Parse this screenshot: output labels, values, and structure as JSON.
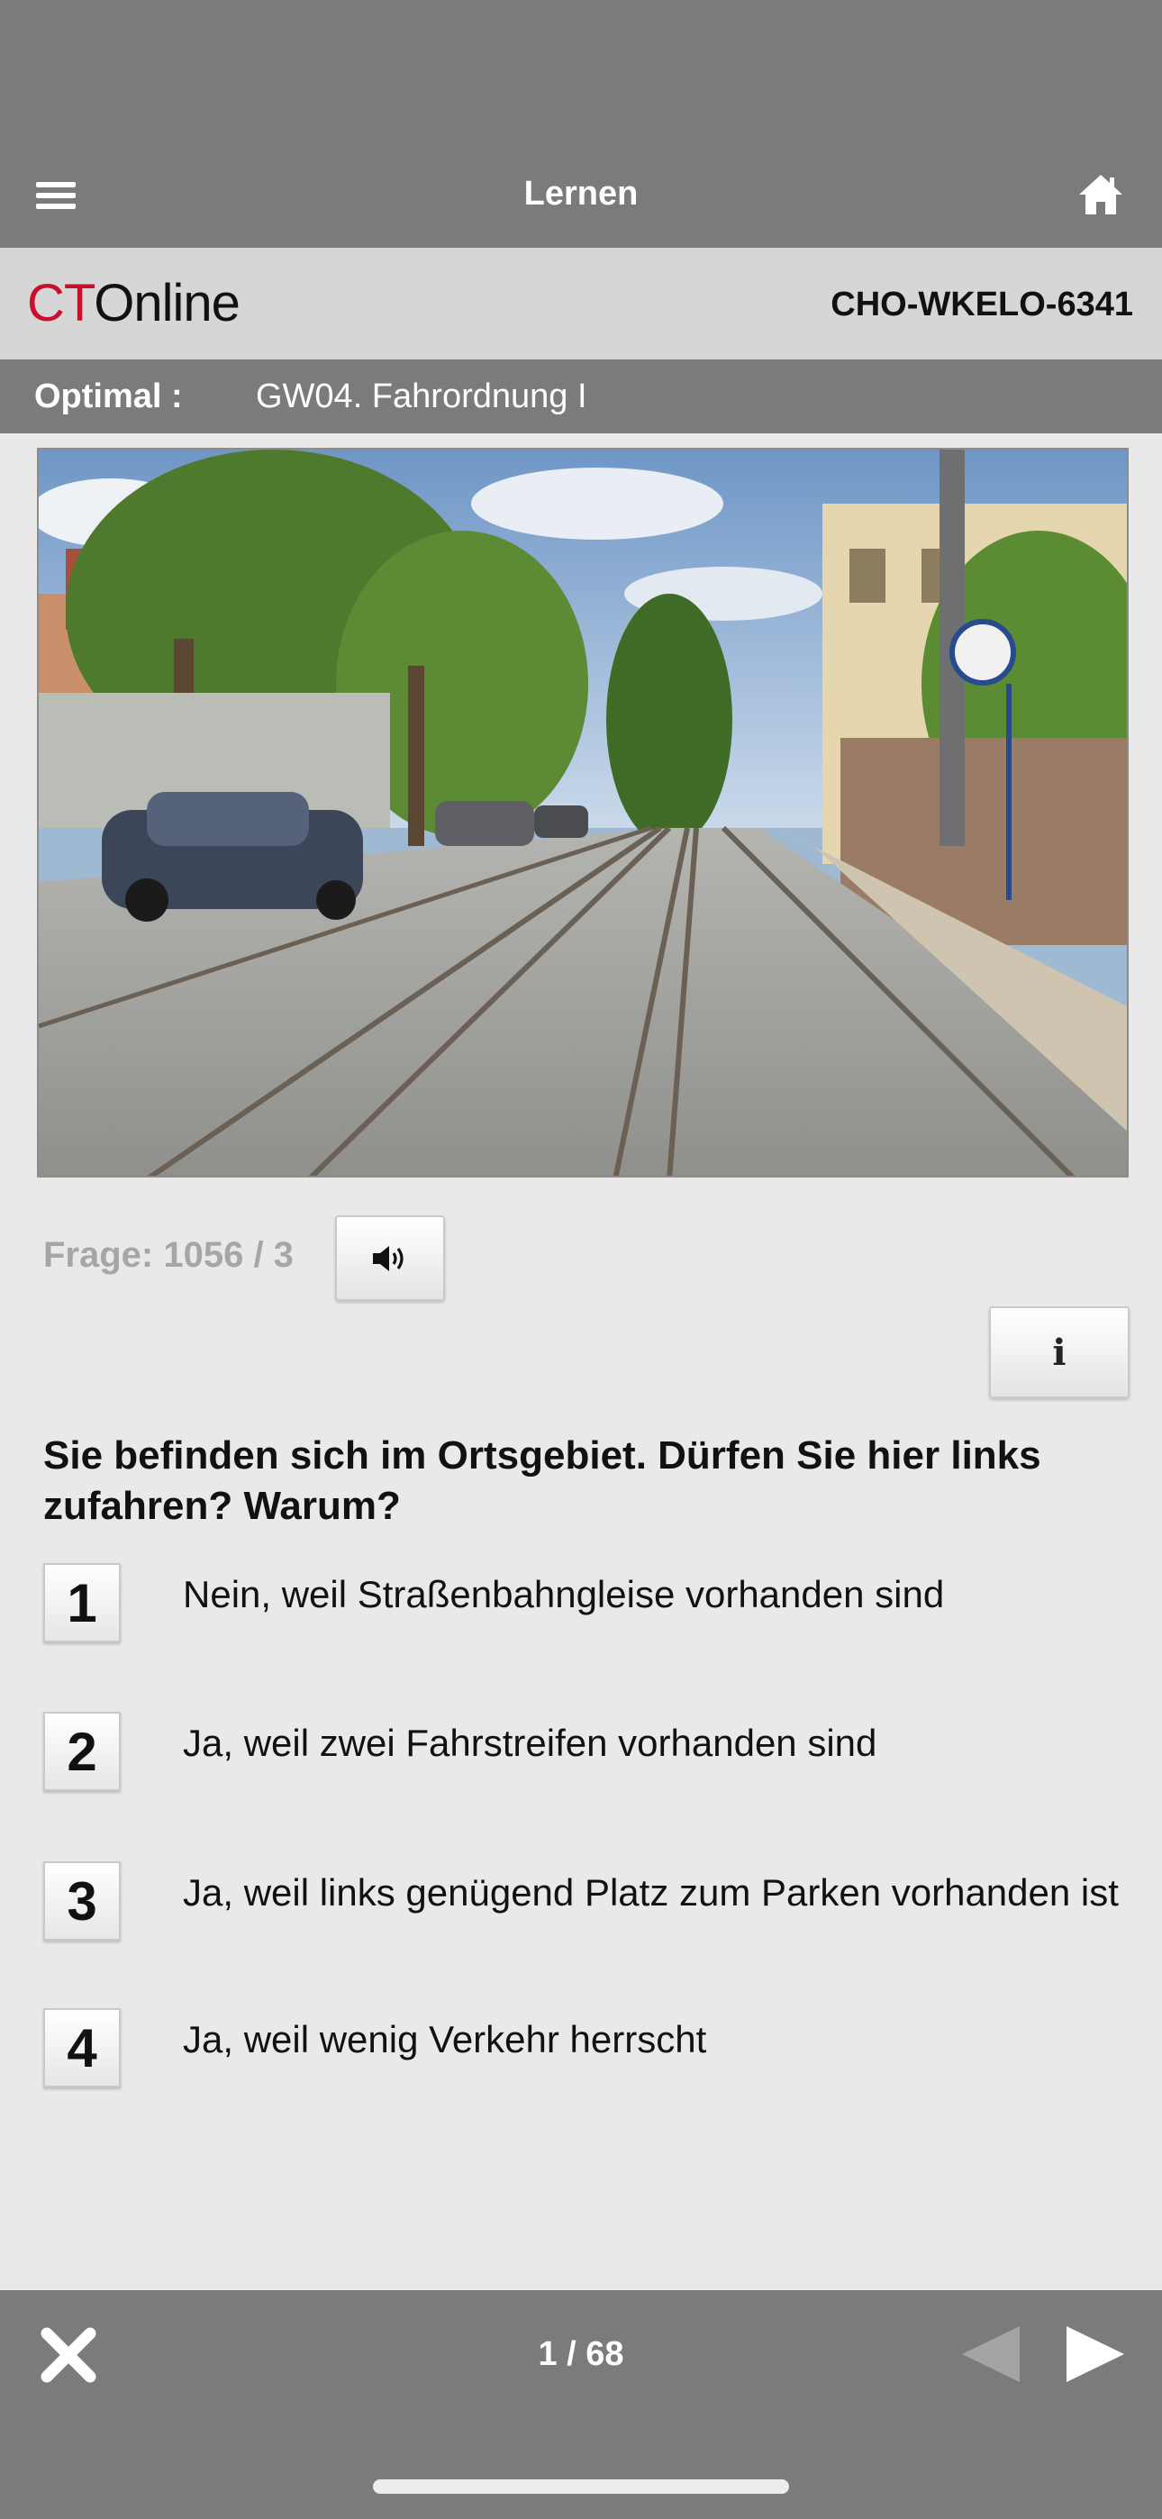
{
  "header": {
    "title": "Lernen"
  },
  "brand": {
    "logo_ct": "CT",
    "logo_online": "Online",
    "code": "CHO-WKELO-6341"
  },
  "subheader": {
    "label": "Optimal :",
    "value": "GW04. Fahrordnung I"
  },
  "question": {
    "counter": "Frage: 1056 / 3",
    "info_label": "i",
    "text": "Sie befinden sich im Ortsgebiet. Dürfen Sie hier links zufahren? Warum?",
    "answers": [
      {
        "number": "1",
        "text": "Nein, weil Straßenbahngleise vorhanden sind"
      },
      {
        "number": "2",
        "text": "Ja, weil zwei Fahrstreifen vorhanden sind"
      },
      {
        "number": "3",
        "text": "Ja, weil links genügend Platz zum Parken vorhanden ist"
      },
      {
        "number": "4",
        "text": "Ja, weil wenig Verkehr herrscht"
      }
    ]
  },
  "footer": {
    "pager": "1 / 68"
  },
  "icons": [
    "menu-icon",
    "home-icon",
    "speaker-icon",
    "info-icon",
    "close-icon",
    "arrow-left-icon",
    "arrow-right-icon"
  ],
  "colors": {
    "bar": "#7b7b7b",
    "brand_bar": "#d6d6d6",
    "logo_red": "#c8102e",
    "background": "#e9e9e9"
  }
}
